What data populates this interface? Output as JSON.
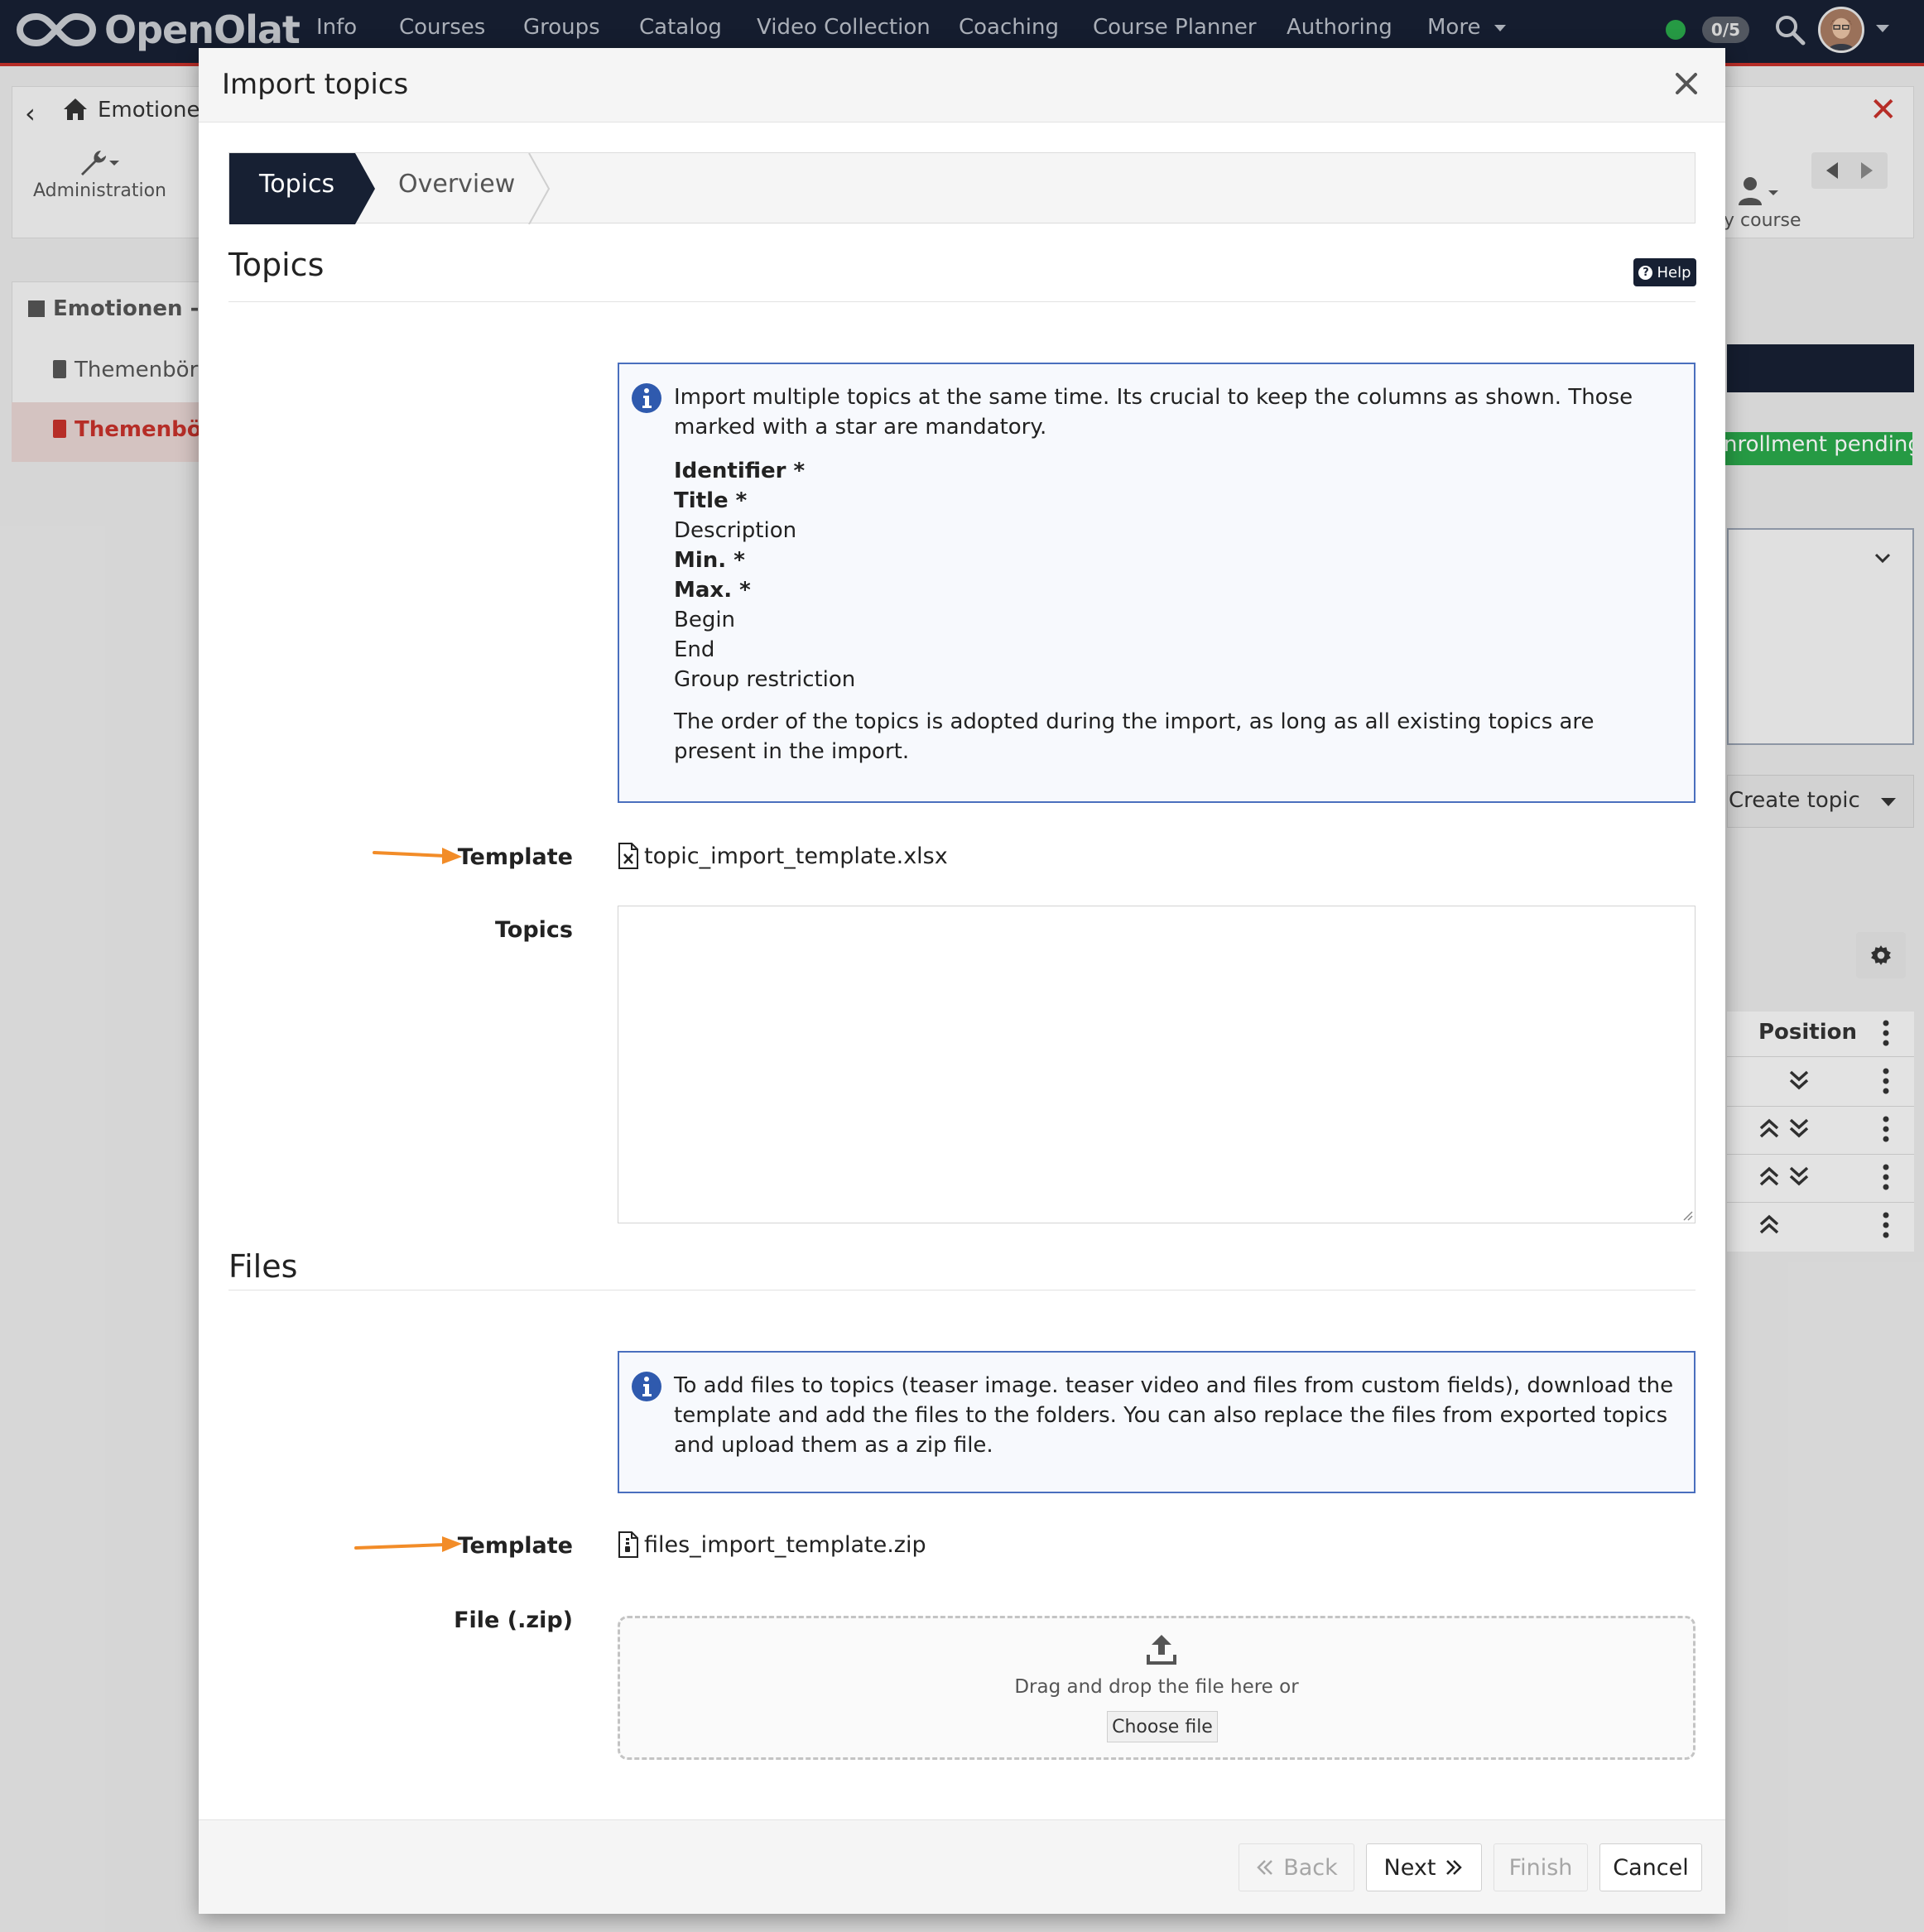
{
  "nav": {
    "brand": "OpenOlat",
    "items": [
      "Info",
      "Courses",
      "Groups",
      "Catalog",
      "Video Collection",
      "Coaching",
      "Course Planner",
      "Authoring",
      "More"
    ],
    "badge_count": "0/5"
  },
  "background": {
    "breadcrumb": "Emotionen",
    "admin_label": "Administration",
    "course_label": "y course",
    "menu_title": "Emotionen - T",
    "menu_item_1": "Themenbörs",
    "menu_item_2": "Themenbör",
    "enrollment_status": "nrollment pending",
    "create_topic": "Create topic",
    "position_header": "Position"
  },
  "modal": {
    "title": "Import topics",
    "steps": [
      {
        "label": "Topics",
        "active": true
      },
      {
        "label": "Overview",
        "active": false
      }
    ],
    "help_label": "Help",
    "topics_section": {
      "title": "Topics",
      "info_intro": "Import multiple topics at the same time. Its crucial to keep the columns as shown. Those marked with a star are mandatory.",
      "fields": [
        {
          "label": "Identifier *",
          "required": true
        },
        {
          "label": "Title *",
          "required": true
        },
        {
          "label": "Description",
          "required": false
        },
        {
          "label": "Min. *",
          "required": true
        },
        {
          "label": "Max. *",
          "required": true
        },
        {
          "label": "Begin",
          "required": false
        },
        {
          "label": "End",
          "required": false
        },
        {
          "label": "Group restriction",
          "required": false
        }
      ],
      "info_outro": "The order of the topics is adopted during the import, as long as all existing topics are present in the import.",
      "template_label": "Template",
      "template_file": "topic_import_template.xlsx",
      "topics_label": "Topics",
      "topics_value": ""
    },
    "files_section": {
      "title": "Files",
      "info_text": "To add files to topics (teaser image. teaser video and files from custom fields), download the template and add the files to the folders. You can also replace the files from exported topics and upload them as a zip file.",
      "template_label": "Template",
      "template_file": "files_import_template.zip",
      "file_label": "File (.zip)",
      "drop_text": "Drag and drop the file here or",
      "choose_file": "Choose file"
    },
    "footer": {
      "back": "Back",
      "next": "Next",
      "finish": "Finish",
      "cancel": "Cancel"
    }
  },
  "colors": {
    "nav_bg": "#172033",
    "accent_red": "#c6312b",
    "info_border": "#4a6fbe",
    "annotation_arrow": "#f28c28",
    "status_green": "#2aa84a"
  }
}
